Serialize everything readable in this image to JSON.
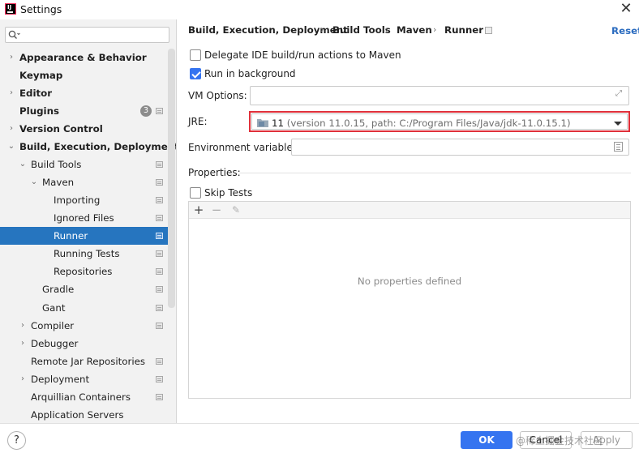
{
  "window": {
    "title": "Settings",
    "close_glyph": "✕"
  },
  "sidebar": {
    "search_placeholder": "",
    "items": [
      {
        "label": "Appearance & Behavior",
        "arrow": "›",
        "bold": true
      },
      {
        "label": "Keymap",
        "bold": true
      },
      {
        "label": "Editor",
        "arrow": "›",
        "bold": true
      },
      {
        "label": "Plugins",
        "bold": true,
        "badge": "3"
      },
      {
        "label": "Version Control",
        "arrow": "›",
        "bold": true
      },
      {
        "label": "Build, Execution, Deployment",
        "arrow": "⌄",
        "bold": true
      },
      {
        "label": "Build Tools",
        "arrow": "⌄"
      },
      {
        "label": "Maven",
        "arrow": "⌄"
      },
      {
        "label": "Importing"
      },
      {
        "label": "Ignored Files"
      },
      {
        "label": "Runner",
        "selected": true
      },
      {
        "label": "Running Tests"
      },
      {
        "label": "Repositories"
      },
      {
        "label": "Gradle"
      },
      {
        "label": "Gant"
      },
      {
        "label": "Compiler",
        "arrow": "›"
      },
      {
        "label": "Debugger",
        "arrow": "›"
      },
      {
        "label": "Remote Jar Repositories"
      },
      {
        "label": "Deployment",
        "arrow": "›"
      },
      {
        "label": "Arquillian Containers"
      },
      {
        "label": "Application Servers"
      }
    ]
  },
  "breadcrumb": {
    "items": [
      "Build, Execution, Deployment",
      "Build Tools",
      "Maven",
      "Runner"
    ],
    "separator": "›"
  },
  "reset_label": "Reset",
  "runner": {
    "delegate_label": "Delegate IDE build/run actions to Maven",
    "delegate_checked": false,
    "background_label": "Run in background",
    "background_checked": true,
    "vm_options_label": "VM Options:",
    "vm_options_value": "",
    "jre_label": "JRE:",
    "jre_version": "11",
    "jre_detail": "(version 11.0.15, path: C:/Program Files/Java/jdk-11.0.15.1)",
    "env_label": "Environment variables:",
    "env_value": "",
    "properties_label": "Properties:",
    "skip_tests_label": "Skip Tests",
    "skip_tests_checked": false,
    "properties_empty": "No properties defined",
    "toolbar": {
      "add": "+",
      "remove": "−",
      "edit": "✎"
    }
  },
  "footer": {
    "help": "?",
    "ok": "OK",
    "cancel": "Cancel",
    "apply": "Apply",
    "watermark": "@稀土掘金技术社区"
  },
  "colors": {
    "accent": "#3574f0",
    "selection": "#2675bf",
    "highlight_border": "#e0303a",
    "link": "#2a6bbf"
  },
  "icons": [
    "app-logo-icon",
    "close-icon",
    "search-icon",
    "expand-icon",
    "folder-icon",
    "dropdown-arrow-icon",
    "env-list-icon",
    "add-icon",
    "remove-icon",
    "edit-icon",
    "help-icon",
    "project-scope-icon"
  ]
}
